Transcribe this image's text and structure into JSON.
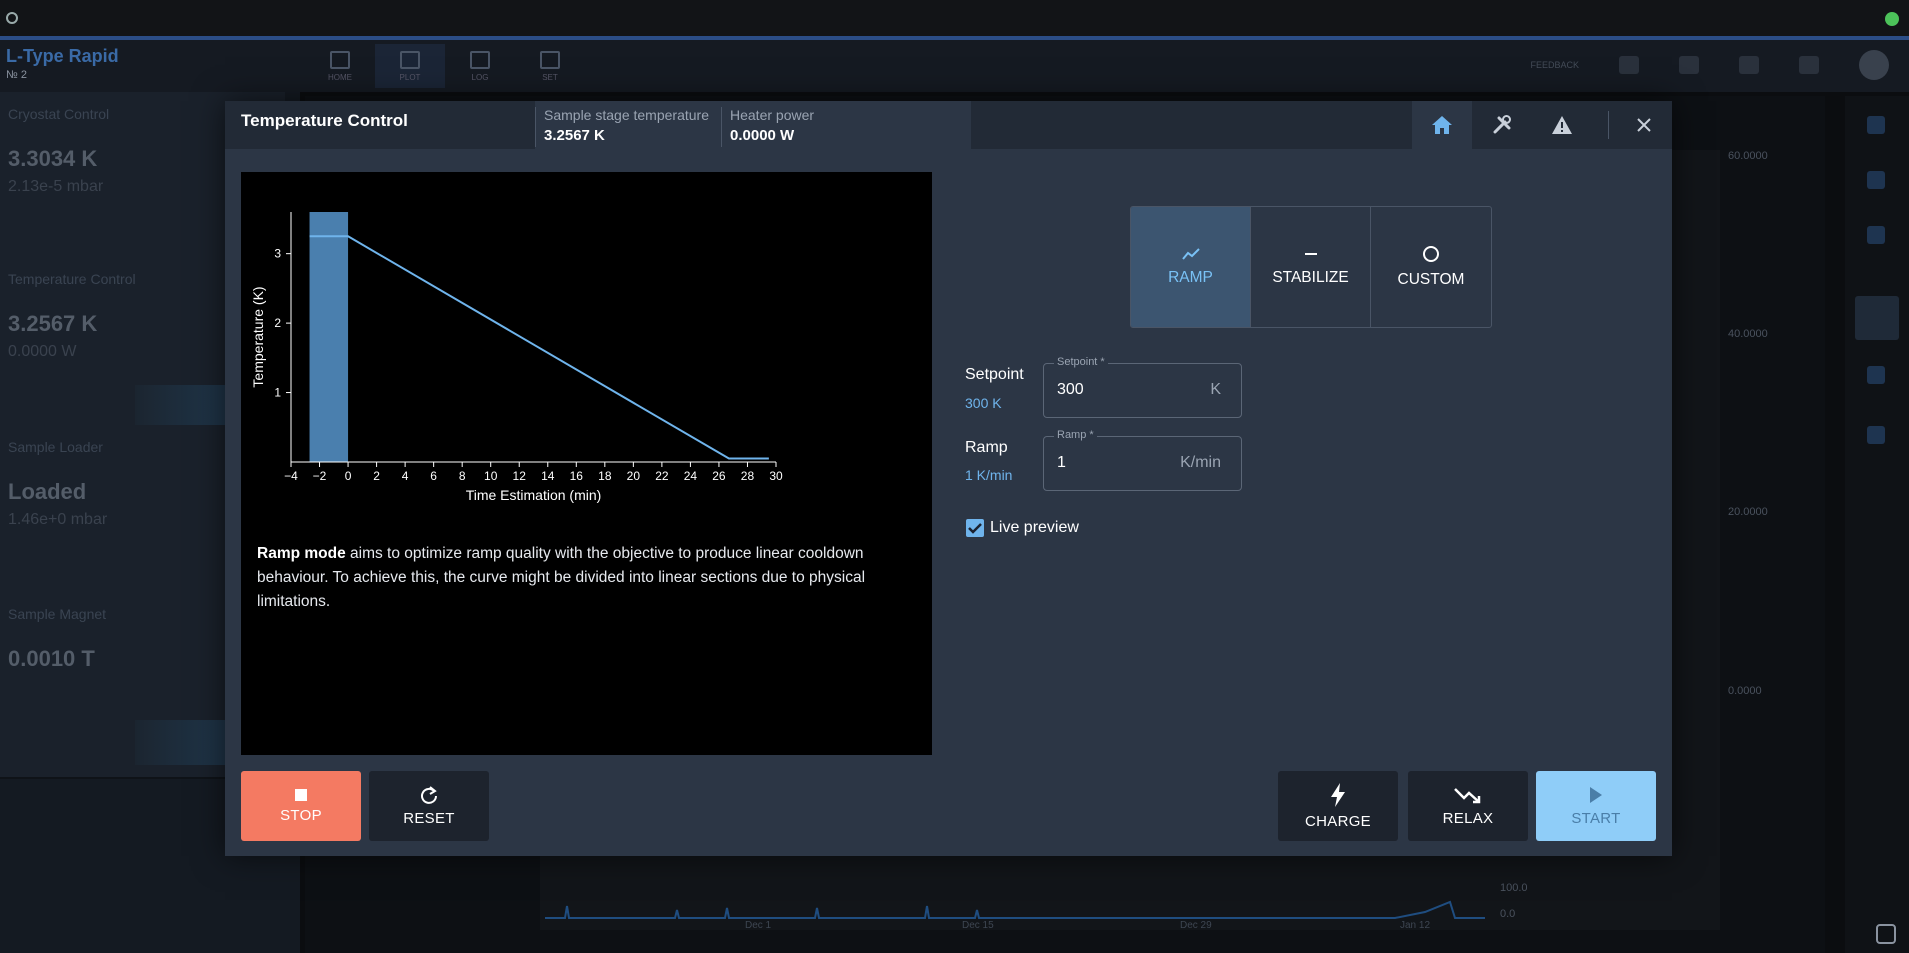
{
  "background": {
    "app_title": "L-Type Rapid",
    "app_subtitle": "№ 2",
    "nav_tabs": [
      "HOME",
      "PLOT",
      "LOG",
      "SET"
    ],
    "nav_right_label": "FEEDBACK",
    "cards": [
      {
        "title": "Cryostat Control",
        "value": "3.3034 K",
        "sub": "2.13e-5 mbar"
      },
      {
        "title": "Temperature Control",
        "value": "3.2567 K",
        "sub": "0.0000 W"
      },
      {
        "title": "Sample Loader",
        "value": "Loaded",
        "sub": "1.46e+0 mbar"
      },
      {
        "title": "Sample Magnet",
        "value": "0.0010 T",
        "sub": ""
      }
    ],
    "right_axis": [
      "60.0000",
      "40.0000",
      "20.0000",
      "0.0000"
    ],
    "dates": [
      "Dec 1",
      "Dec 15",
      "Dec 29",
      "Jan 12"
    ],
    "mini_axis": [
      "100.0",
      "0.0"
    ]
  },
  "modal": {
    "title": "Temperature Control",
    "stats": [
      {
        "label": "Sample stage temperature",
        "value": "3.2567 K"
      },
      {
        "label": "Heater power",
        "value": "0.0000 W"
      }
    ],
    "header_tabs": [
      "home-icon",
      "tools-icon",
      "warning-icon"
    ],
    "close_icon": "close-icon",
    "modes": [
      {
        "label": "RAMP",
        "icon": "ramp-icon",
        "active": true
      },
      {
        "label": "STABILIZE",
        "icon": "stabilize-icon",
        "active": false
      },
      {
        "label": "CUSTOM",
        "icon": "custom-icon",
        "active": false
      }
    ],
    "setpoint": {
      "label": "Setpoint",
      "current": "300 K",
      "field_label": "Setpoint *",
      "value": "300",
      "unit": "K"
    },
    "ramp": {
      "label": "Ramp",
      "current": "1 K/min",
      "field_label": "Ramp *",
      "value": "1",
      "unit": "K/min"
    },
    "live_preview": {
      "label": "Live preview",
      "checked": true
    },
    "description_bold": "Ramp mode",
    "description_rest": " aims to optimize ramp quality with the objective to produce linear cooldown behaviour. To achieve this, the curve might be divided into linear sections due to physical limitations.",
    "buttons": {
      "stop": "STOP",
      "reset": "RESET",
      "charge": "CHARGE",
      "relax": "RELAX",
      "start": "START"
    }
  },
  "chart_data": {
    "type": "line",
    "xlabel": "Time Estimation (min)",
    "ylabel": "Temperature (K)",
    "xlim": [
      -4,
      30
    ],
    "ylim": [
      0,
      3.6
    ],
    "xticks": [
      -4,
      -2,
      0,
      2,
      4,
      6,
      8,
      10,
      12,
      14,
      16,
      18,
      20,
      22,
      24,
      26,
      28,
      30
    ],
    "yticks": [
      1,
      2,
      3
    ],
    "highlight_region": [
      -2.7,
      0
    ],
    "series": [
      {
        "x": [
          -2.7,
          0,
          26.7,
          29.5
        ],
        "y": [
          3.25,
          3.25,
          0.05,
          0.05
        ],
        "color": "#6fb4ec"
      }
    ],
    "grid": false
  }
}
